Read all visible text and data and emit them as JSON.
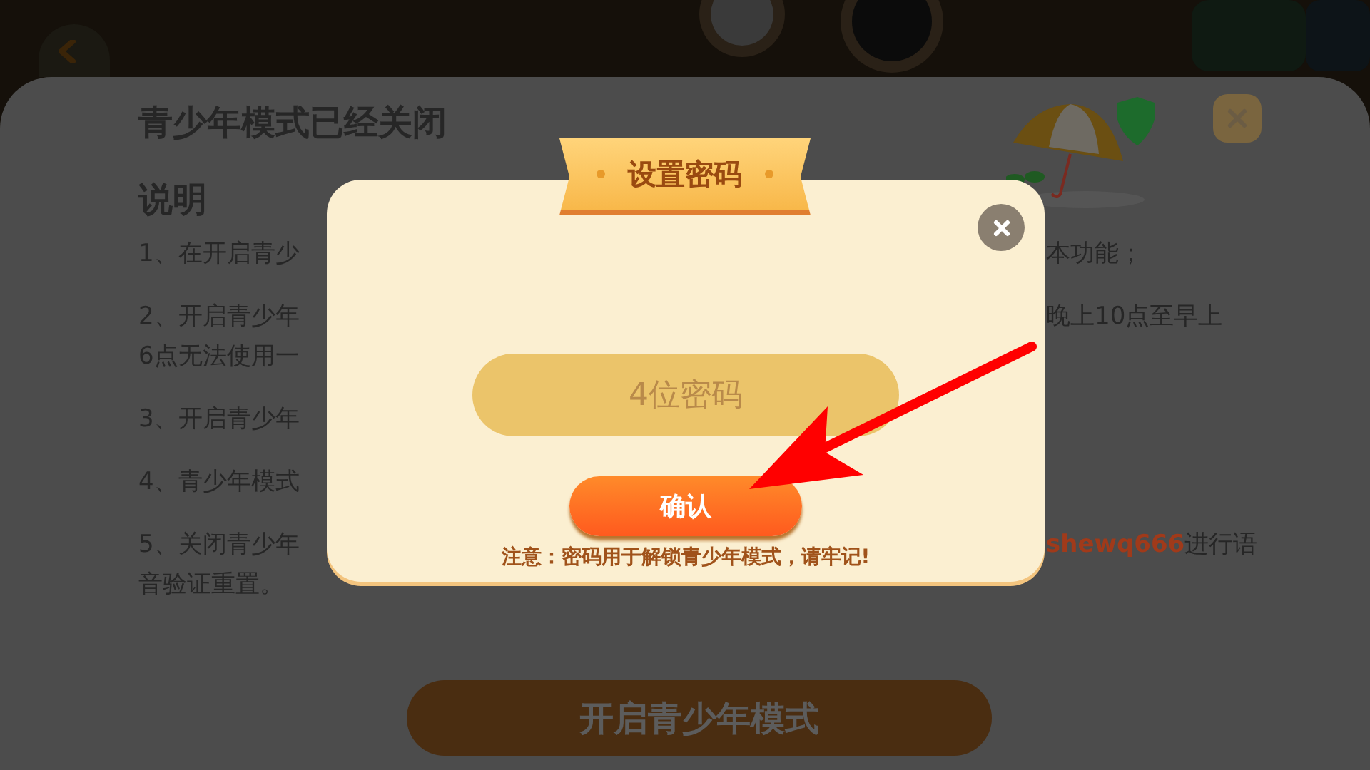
{
  "background_page": {
    "title": "青少年模式已经关闭",
    "section_heading": "说明",
    "paragraphs": [
      {
        "lines": [
          {
            "left": "1、在开启青少",
            "right": "本功能；"
          }
        ]
      },
      {
        "lines": [
          {
            "left": "2、开启青少年",
            "right": "晚上10点至早上"
          },
          {
            "left": "6点无法使用一"
          }
        ]
      },
      {
        "lines": [
          {
            "left": "3、开启青少年"
          }
        ]
      },
      {
        "lines": [
          {
            "left": "4、青少年模式"
          }
        ]
      },
      {
        "lines": [
          {
            "left": "5、关闭青少年",
            "right": "**shewq666**进行语"
          },
          {
            "left": "音验证重置。"
          }
        ]
      }
    ],
    "start_button": "开启青少年模式"
  },
  "dialog": {
    "title": "设置密码",
    "password_field": {
      "placeholder": "4位密码"
    },
    "confirm_button": "确认",
    "note": "注意：密码用于解锁青少年模式，请牢记!"
  }
}
